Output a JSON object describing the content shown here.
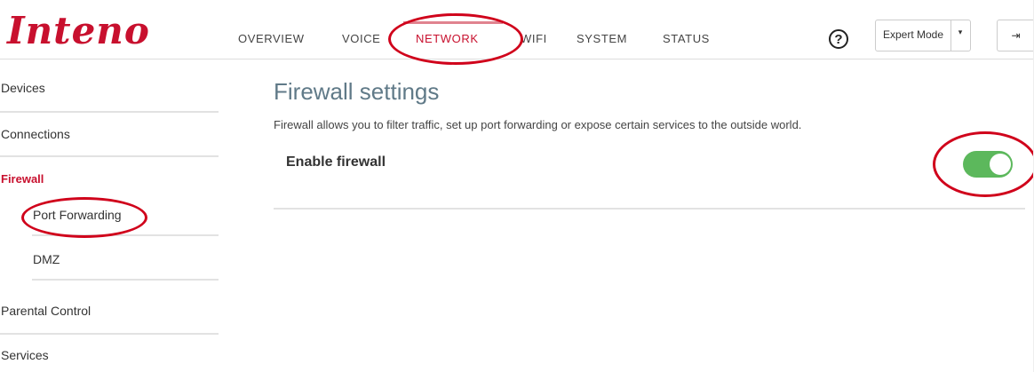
{
  "brand": {
    "logo_text": "Inteno"
  },
  "nav": {
    "items": [
      {
        "label": "OVERVIEW"
      },
      {
        "label": "VOICE"
      },
      {
        "label": "NETWORK"
      },
      {
        "label": "WIFI"
      },
      {
        "label": "SYSTEM"
      },
      {
        "label": "STATUS"
      }
    ],
    "active": "NETWORK"
  },
  "header": {
    "help_symbol": "?",
    "mode_select_value": "Expert Mode",
    "mode_caret": "▾",
    "logout_symbol": "⇥"
  },
  "sidebar": {
    "items": [
      {
        "label": "Devices"
      },
      {
        "label": "Connections"
      },
      {
        "label": "Firewall"
      },
      {
        "label": "Port Forwarding"
      },
      {
        "label": "DMZ"
      },
      {
        "label": "Parental Control"
      },
      {
        "label": "Services"
      }
    ],
    "active": "Firewall"
  },
  "main": {
    "title": "Firewall settings",
    "description": "Firewall allows you to filter traffic, set up port forwarding or expose certain services to the outside world.",
    "setting_label": "Enable firewall",
    "firewall_enabled": true
  },
  "colors": {
    "brand_red": "#c8102e",
    "toggle_on": "#5cb85c",
    "title_color": "#607a88",
    "annotation_red": "#d0021b"
  },
  "icons": {
    "help": "question-circle-icon",
    "caret": "caret-down-icon",
    "logout": "sign-out-icon"
  }
}
